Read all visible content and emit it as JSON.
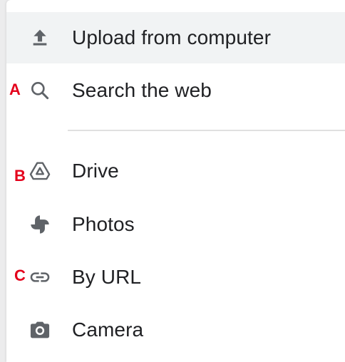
{
  "menu": {
    "items": [
      {
        "label": "Upload from computer",
        "icon": "upload-icon"
      },
      {
        "label": "Search the web",
        "icon": "search-icon"
      },
      {
        "label": "Drive",
        "icon": "drive-icon"
      },
      {
        "label": "Photos",
        "icon": "photos-icon"
      },
      {
        "label": "By URL",
        "icon": "link-icon"
      },
      {
        "label": "Camera",
        "icon": "camera-icon"
      }
    ]
  },
  "markers": [
    "A",
    "B",
    "C"
  ],
  "colors": {
    "text": "#202124",
    "icon": "#5f6368",
    "hover_bg": "#f1f3f4",
    "divider": "#e0e0e0",
    "marker": "#e4001b"
  }
}
